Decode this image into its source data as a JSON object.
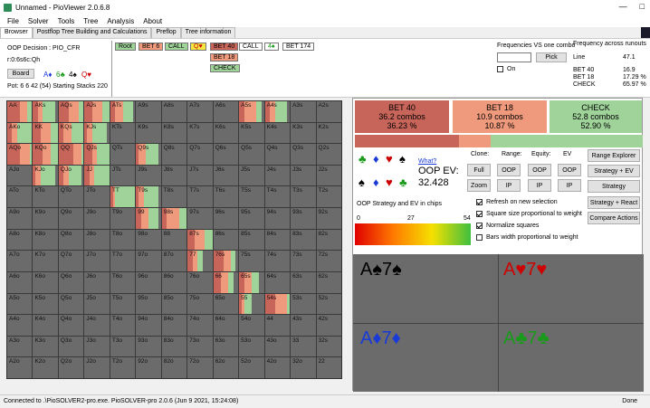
{
  "window": {
    "title": "Unnamed - PioViewer 2.0.6.8",
    "minimize": "—",
    "maximize": "□"
  },
  "menu": [
    "File",
    "Solver",
    "Tools",
    "Tree",
    "Analysis",
    "About"
  ],
  "tabs": [
    "Browser",
    "Postflop Tree Building and Calculations",
    "Preflop",
    "Tree information"
  ],
  "top": {
    "decision": "OOP Decision : PIO_CFR",
    "board_text": "r:0:6s6c:Qh",
    "board_button": "Board",
    "board_cards": [
      "A♦",
      "6♣",
      "4♠",
      "Q♥"
    ],
    "pot": "Pot: 6 6 42 (54) Starting Stacks 220",
    "line1": [
      "Root",
      "BET 6",
      "CALL",
      "Q♥",
      "BET 40",
      "CALL",
      "4♠",
      "BET 174"
    ],
    "line2": "BET 18",
    "line3": "CHECK",
    "freq_label": "Frequencies VS one combo",
    "pick": "Pick",
    "on": "On",
    "freq_across": "Frequency across runouts",
    "line_label": "Line",
    "line_val": "47.1",
    "stats": [
      "BET 40",
      "BET 18",
      "CHECK"
    ],
    "stats_vals": [
      "16.9",
      "17.29 %",
      "65.97 %"
    ]
  },
  "grid": {
    "rows": [
      [
        "AA",
        "AKs",
        "AQs",
        "AJs",
        "ATs",
        "A9s",
        "A8s",
        "A7s",
        "A6s",
        "A5s",
        "A4s",
        "A3s",
        "A2s"
      ],
      [
        "AKo",
        "KK",
        "KQs",
        "KJs",
        "KTs",
        "K9s",
        "K8s",
        "K7s",
        "K6s",
        "K5s",
        "K4s",
        "K3s",
        "K2s"
      ],
      [
        "AQo",
        "KQo",
        "QQ",
        "QJs",
        "QTs",
        "Q9s",
        "Q8s",
        "Q7s",
        "Q6s",
        "Q5s",
        "Q4s",
        "Q3s",
        "Q2s"
      ],
      [
        "AJo",
        "KJo",
        "QJo",
        "JJ",
        "JTs",
        "J9s",
        "J8s",
        "J7s",
        "J6s",
        "J5s",
        "J4s",
        "J3s",
        "J2s"
      ],
      [
        "ATo",
        "KTo",
        "QTo",
        "JTo",
        "TT",
        "T9s",
        "T8s",
        "T7s",
        "T6s",
        "T5s",
        "T4s",
        "T3s",
        "T2s"
      ],
      [
        "A9o",
        "K9o",
        "Q9o",
        "J9o",
        "T9o",
        "99",
        "98s",
        "97s",
        "96s",
        "95s",
        "94s",
        "93s",
        "92s"
      ],
      [
        "A8o",
        "K8o",
        "Q8o",
        "J8o",
        "T8o",
        "98o",
        "88",
        "87s",
        "86s",
        "85s",
        "84s",
        "83s",
        "82s"
      ],
      [
        "A7o",
        "K7o",
        "Q7o",
        "J7o",
        "T7o",
        "97o",
        "87o",
        "77",
        "76s",
        "75s",
        "74s",
        "73s",
        "72s"
      ],
      [
        "A6o",
        "K6o",
        "Q6o",
        "J6o",
        "T6o",
        "96o",
        "86o",
        "76o",
        "66",
        "65s",
        "64s",
        "63s",
        "62s"
      ],
      [
        "A5o",
        "K5o",
        "Q5o",
        "J5o",
        "T5o",
        "95o",
        "85o",
        "75o",
        "65o",
        "55",
        "54s",
        "53s",
        "52s"
      ],
      [
        "A4o",
        "K4o",
        "Q4o",
        "J4o",
        "T4o",
        "94o",
        "84o",
        "74o",
        "64o",
        "54o",
        "44",
        "43s",
        "42s"
      ],
      [
        "A3o",
        "K3o",
        "Q3o",
        "J3o",
        "T3o",
        "93o",
        "83o",
        "73o",
        "63o",
        "53o",
        "43o",
        "33",
        "32s"
      ],
      [
        "A2o",
        "K2o",
        "Q2o",
        "J2o",
        "T2o",
        "92o",
        "82o",
        "72o",
        "62o",
        "52o",
        "42o",
        "32o",
        "22"
      ]
    ],
    "colors": {
      "bet40": "#c8655a",
      "bet18": "#ef9a7c",
      "check": "#9fd39a",
      "empty": "#6b6b6b"
    },
    "strats": {
      "AA": [
        0.5,
        0.3,
        0.2
      ],
      "AKs": [
        0.2,
        0.2,
        0.5
      ],
      "AQs": [
        0.4,
        0.4,
        0.2
      ],
      "AJs": [
        0.3,
        0.4,
        0.3
      ],
      "ATs": [
        0.2,
        0.3,
        0.4
      ],
      "A5s": [
        0.2,
        0.5,
        0.2
      ],
      "A4s": [
        0.2,
        0.2,
        0.5
      ],
      "AKo": [
        0.2,
        0.2,
        0.6
      ],
      "KK": [
        0.3,
        0.4,
        0.3
      ],
      "KQs": [
        0.2,
        0.3,
        0.5
      ],
      "KJs": [
        0.1,
        0.2,
        0.6
      ],
      "AQo": [
        0.5,
        0.4,
        0.1
      ],
      "KQo": [
        0.4,
        0.3,
        0.3
      ],
      "QQ": [
        0.6,
        0.3,
        0.1
      ],
      "QJs": [
        0.3,
        0.2,
        0.5
      ],
      "Q9s": [
        0.1,
        0.3,
        0.5
      ],
      "KJo": [
        0.1,
        0.2,
        0.6
      ],
      "QJo": [
        0.2,
        0.2,
        0.5
      ],
      "JJ": [
        0.2,
        0.2,
        0.6
      ],
      "TT": [
        0.1,
        0.1,
        0.8
      ],
      "T9s": [
        0.1,
        0.2,
        0.6
      ],
      "99": [
        0.2,
        0.3,
        0.4
      ],
      "98s": [
        0.2,
        0.5,
        0.3
      ],
      "87s": [
        0.3,
        0.4,
        0.3
      ],
      "77": [
        0.2,
        0.2,
        0.2
      ],
      "76s": [
        0.4,
        0.3,
        0.2
      ],
      "66": [
        0.3,
        0.3,
        0.2
      ],
      "65s": [
        0.2,
        0.3,
        0.3
      ],
      "55": [
        0.1,
        0.1,
        0.3
      ],
      "54s": [
        0.4,
        0.5,
        0.1
      ]
    }
  },
  "actions": [
    {
      "name": "BET 40",
      "combos": "36.2 combos",
      "pct": "36.23 %",
      "color": "#c8655a",
      "frac": 0.362
    },
    {
      "name": "BET 18",
      "combos": "10.9 combos",
      "pct": "10.87 %",
      "color": "#ef9a7c",
      "frac": 0.109
    },
    {
      "name": "CHECK",
      "combos": "52.8 combos",
      "pct": "52.90 %",
      "color": "#9fd39a",
      "frac": 0.529
    }
  ],
  "controls": {
    "what": "What?",
    "ev_label": "OOP EV:",
    "ev_value": "32.428",
    "headers": [
      "Clone:",
      "Range:",
      "Equity:",
      "EV"
    ],
    "row1": [
      "Full",
      "OOP",
      "OOP",
      "OOP"
    ],
    "row2": [
      "Zoom",
      "IP",
      "IP",
      "IP"
    ],
    "side_buttons": [
      "Range Explorer",
      "Strategy + EV",
      "Strategy",
      "Strategy + React",
      "Compare Actions"
    ],
    "legend_title": "OOP Strategy and EV in chips",
    "legend_min": "0",
    "legend_mid": "27",
    "legend_max": "54",
    "checks": [
      "Refresh on new selection",
      "Square size proportional to weight",
      "Normalize squares",
      "Bars width proportional to weight"
    ],
    "checks_on": [
      true,
      true,
      true,
      false
    ]
  },
  "combos": [
    {
      "text": "A♠7♠",
      "color": "#000"
    },
    {
      "text": "A♥7♥",
      "color": "#cc0000"
    },
    {
      "text": "A♦7♦",
      "color": "#1a3ad8"
    },
    {
      "text": "A♣7♣",
      "color": "#1a9a1a"
    }
  ],
  "status": {
    "left": "Connected to .\\PioSOLVER2-pro.exe. PioSOLVER-pro 2.0.6 (Jun  9 2021, 15:24:08)",
    "right": "Done"
  }
}
